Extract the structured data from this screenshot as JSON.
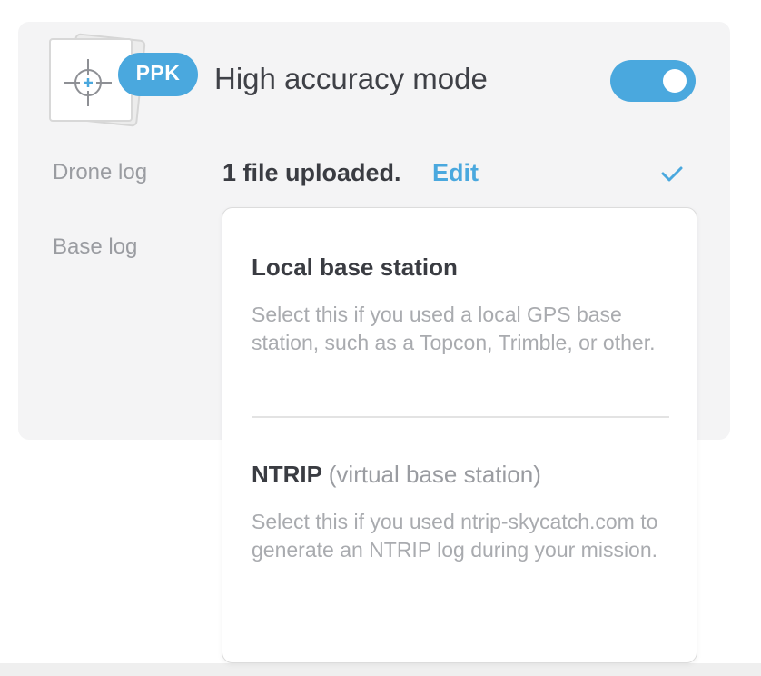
{
  "ppk_card": {
    "badge_label": "PPK",
    "title": "High accuracy mode",
    "toggle_on": true,
    "accent_color": "#4aa8de",
    "icons": {
      "mode_icon": "crosshair-icon",
      "status_icon": "checkmark-icon"
    },
    "drone_log": {
      "label": "Drone log",
      "status": "1 file uploaded.",
      "edit_label": "Edit"
    },
    "base_log": {
      "label": "Base log"
    }
  },
  "base_station_menu": {
    "options": [
      {
        "title": "Local base station",
        "subtitle": "",
        "description": "Select this if you used a local GPS base station, such as a Topcon, Trimble, or other."
      },
      {
        "title": "NTRIP",
        "subtitle": "(virtual base station)",
        "description": "Select this if you used ntrip-skycatch.com to generate an NTRIP log during your mission."
      }
    ]
  }
}
